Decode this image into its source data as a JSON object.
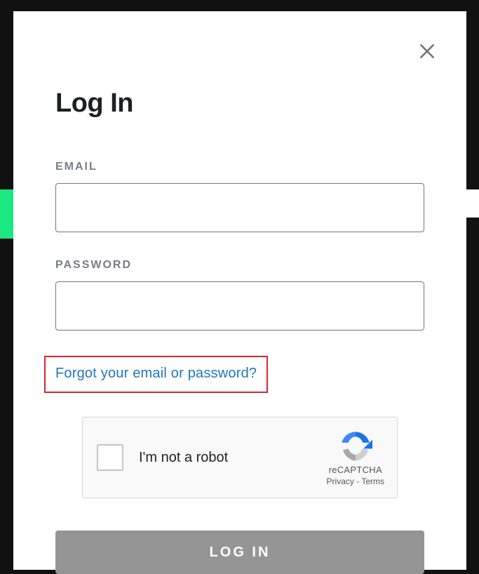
{
  "modal": {
    "title": "Log In",
    "email_label": "EMAIL",
    "email_value": "",
    "password_label": "PASSWORD",
    "password_value": "",
    "forgot_link": "Forgot your email or password?",
    "login_button": "LOG IN"
  },
  "recaptcha": {
    "label": "I'm not a robot",
    "brand": "reCAPTCHA",
    "privacy": "Privacy",
    "separator": " - ",
    "terms": "Terms"
  },
  "colors": {
    "link": "#2176bd",
    "annotation_border": "#d6292c",
    "button_bg": "#959595"
  }
}
